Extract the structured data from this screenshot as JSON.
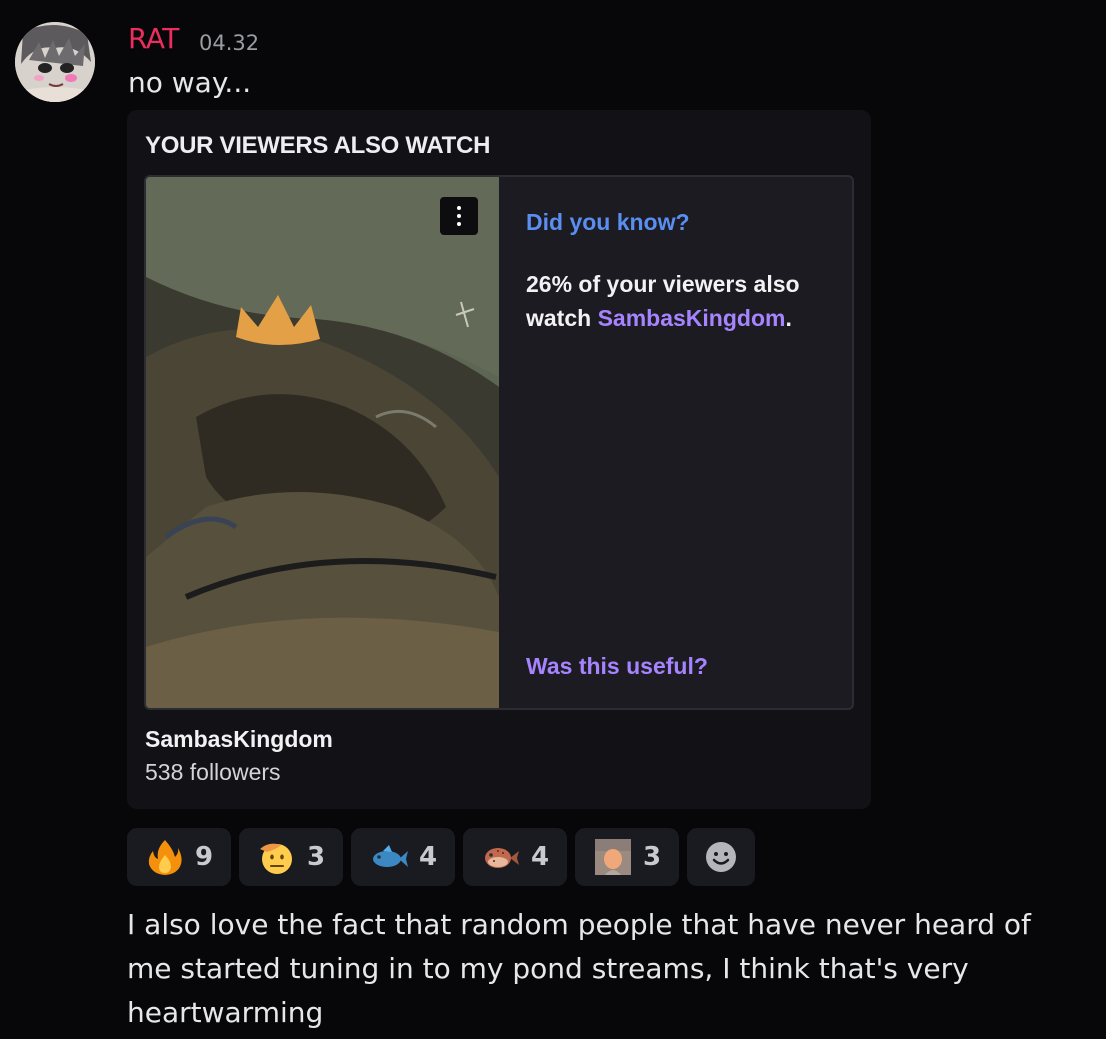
{
  "message": {
    "username": "RAT",
    "timestamp": "04.32",
    "text": "no way..."
  },
  "embed": {
    "title": "YOUR VIEWERS ALSO WATCH",
    "did_you_know": "Did you know?",
    "stat_text": "26% of your viewers also watch ",
    "channel_link": "SambasKingdom",
    "stat_suffix": ".",
    "useful_prompt": "Was this useful?",
    "channel_name": "SambasKingdom",
    "followers": "538 followers"
  },
  "reactions": [
    {
      "icon": "fire-emoji-icon",
      "count": "9"
    },
    {
      "icon": "saluting-face-emoji-icon",
      "count": "3"
    },
    {
      "icon": "fish-emoji-icon",
      "count": "4"
    },
    {
      "icon": "blowfish-emoji-icon",
      "count": "4"
    },
    {
      "icon": "custom-emoji-icon",
      "count": "3"
    }
  ],
  "followup_message": "I also love the fact that random people that have never heard of me started tuning in to my pond streams, I think that's very heartwarming",
  "colors": {
    "background": "#070709",
    "username": "#ec2e5e",
    "embed_bg": "#121216",
    "link_blue": "#5a8ef0",
    "link_purple": "#a784ff"
  }
}
